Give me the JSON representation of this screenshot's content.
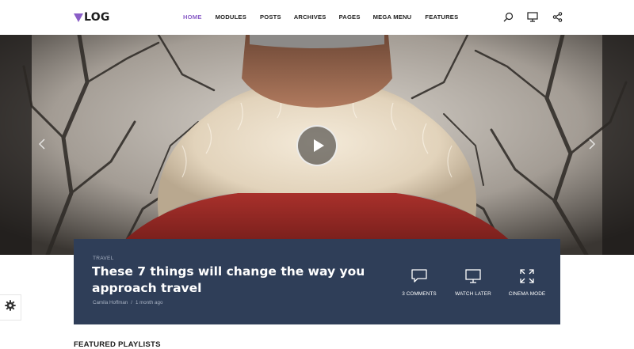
{
  "brand": {
    "logo_text": "LOG",
    "accent_color": "#8a5ec7"
  },
  "nav": {
    "items": [
      {
        "label": "HOME",
        "active": true
      },
      {
        "label": "MODULES",
        "active": false
      },
      {
        "label": "POSTS",
        "active": false
      },
      {
        "label": "ARCHIVES",
        "active": false
      },
      {
        "label": "PAGES",
        "active": false
      },
      {
        "label": "MEGA MENU",
        "active": false
      },
      {
        "label": "FEATURES",
        "active": false
      }
    ]
  },
  "header_icons": [
    "search-icon",
    "monitor-icon",
    "share-icon"
  ],
  "hero": {
    "category": "TRAVEL",
    "title": "These 7 things will change the way you approach travel",
    "author": "Camila Hoffman",
    "separator": "/",
    "time": "1 month ago",
    "actions": [
      {
        "icon": "comment-icon",
        "label": "3 COMMENTS"
      },
      {
        "icon": "monitor-icon",
        "label": "WATCH LATER"
      },
      {
        "icon": "expand-icon",
        "label": "CINEMA MODE"
      }
    ],
    "panel_color": "#2f3e58"
  },
  "section": {
    "title": "FEATURED PLAYLISTS"
  }
}
